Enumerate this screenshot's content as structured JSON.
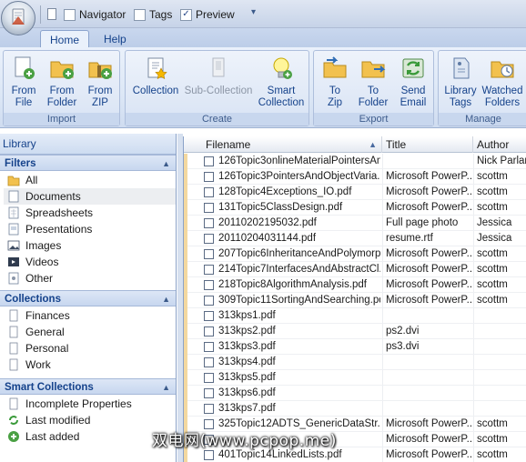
{
  "qat": {
    "navigator_label": "Navigator",
    "navigator_checked": false,
    "tags_label": "Tags",
    "tags_checked": false,
    "preview_label": "Preview",
    "preview_checked": true,
    "customize_glyph": "▾"
  },
  "tabs": [
    {
      "label": "Home",
      "active": true
    },
    {
      "label": "Help",
      "active": false
    }
  ],
  "ribbon": {
    "groups": [
      {
        "label": "Import",
        "buttons": [
          {
            "label": "From\nFile",
            "icon": "import-file-icon"
          },
          {
            "label": "From\nFolder",
            "icon": "import-folder-icon"
          },
          {
            "label": "From\nZIP",
            "icon": "import-zip-icon"
          }
        ]
      },
      {
        "label": "Create",
        "buttons": [
          {
            "label": "Collection",
            "icon": "collection-star-icon"
          },
          {
            "label": "Sub-Collection",
            "icon": "sub-collection-icon",
            "disabled": true
          },
          {
            "label": "Smart\nCollection",
            "icon": "smart-collection-bulb-icon"
          }
        ]
      },
      {
        "label": "Export",
        "buttons": [
          {
            "label": "To\nZip",
            "icon": "export-zip-icon"
          },
          {
            "label": "To\nFolder",
            "icon": "export-folder-icon"
          },
          {
            "label": "Send\nEmail",
            "icon": "send-email-icon"
          }
        ]
      },
      {
        "label": "Manage",
        "buttons": [
          {
            "label": "Library\nTags",
            "icon": "library-tags-icon"
          },
          {
            "label": "Watched\nFolders",
            "icon": "watched-folders-icon"
          }
        ]
      }
    ]
  },
  "library": {
    "title": "Library",
    "filters_title": "Filters",
    "filters": [
      {
        "label": "All",
        "icon": "folder-icon"
      },
      {
        "label": "Documents",
        "icon": "document-icon",
        "selected": true
      },
      {
        "label": "Spreadsheets",
        "icon": "spreadsheet-icon"
      },
      {
        "label": "Presentations",
        "icon": "presentation-icon"
      },
      {
        "label": "Images",
        "icon": "image-icon"
      },
      {
        "label": "Videos",
        "icon": "video-icon"
      },
      {
        "label": "Other",
        "icon": "other-file-icon"
      }
    ],
    "collections_title": "Collections",
    "collections": [
      {
        "label": "Finances"
      },
      {
        "label": "General"
      },
      {
        "label": "Personal"
      },
      {
        "label": "Work"
      }
    ],
    "smart_title": "Smart Collections",
    "smart": [
      {
        "label": "Incomplete Properties",
        "icon": "incomplete-doc-icon"
      },
      {
        "label": "Last modified",
        "icon": "refresh-icon"
      },
      {
        "label": "Last added",
        "icon": "add-icon"
      }
    ]
  },
  "table": {
    "columns": [
      "Filename",
      "Title",
      "Author"
    ],
    "sort_glyph": "▲",
    "rows": [
      [
        "126Topic3onlineMaterialPointersAn...",
        "",
        "Nick Parlan"
      ],
      [
        "126Topic3PointersAndObjectVaria...",
        "Microsoft PowerP...",
        "scottm"
      ],
      [
        "128Topic4Exceptions_IO.pdf",
        "Microsoft PowerP...",
        "scottm"
      ],
      [
        "131Topic5ClassDesign.pdf",
        "Microsoft PowerP...",
        "scottm"
      ],
      [
        "20110202195032.pdf",
        "Full page photo",
        "Jessica"
      ],
      [
        "20110204031144.pdf",
        "resume.rtf",
        "Jessica"
      ],
      [
        "207Topic6InheritanceAndPolymorp...",
        "Microsoft PowerP...",
        "scottm"
      ],
      [
        "214Topic7InterfacesAndAbstractCl...",
        "Microsoft PowerP...",
        "scottm"
      ],
      [
        "218Topic8AlgorithmAnalysis.pdf",
        "Microsoft PowerP...",
        "scottm"
      ],
      [
        "309Topic11SortingAndSearching.pdf",
        "Microsoft PowerP...",
        "scottm"
      ],
      [
        "313kps1.pdf",
        "",
        ""
      ],
      [
        "313kps2.pdf",
        "ps2.dvi",
        ""
      ],
      [
        "313kps3.pdf",
        "ps3.dvi",
        ""
      ],
      [
        "313kps4.pdf",
        "",
        ""
      ],
      [
        "313kps5.pdf",
        "",
        ""
      ],
      [
        "313kps6.pdf",
        "",
        ""
      ],
      [
        "313kps7.pdf",
        "",
        ""
      ],
      [
        "325Topic12ADTS_GenericDataStr...",
        "Microsoft PowerP...",
        "scottm"
      ],
      [
        "",
        "Microsoft PowerP...",
        "scottm"
      ],
      [
        "401Topic14LinkedLists.pdf",
        "Microsoft PowerP...",
        "scottm"
      ]
    ]
  },
  "watermark": "双电网(www.pcpop.me)"
}
